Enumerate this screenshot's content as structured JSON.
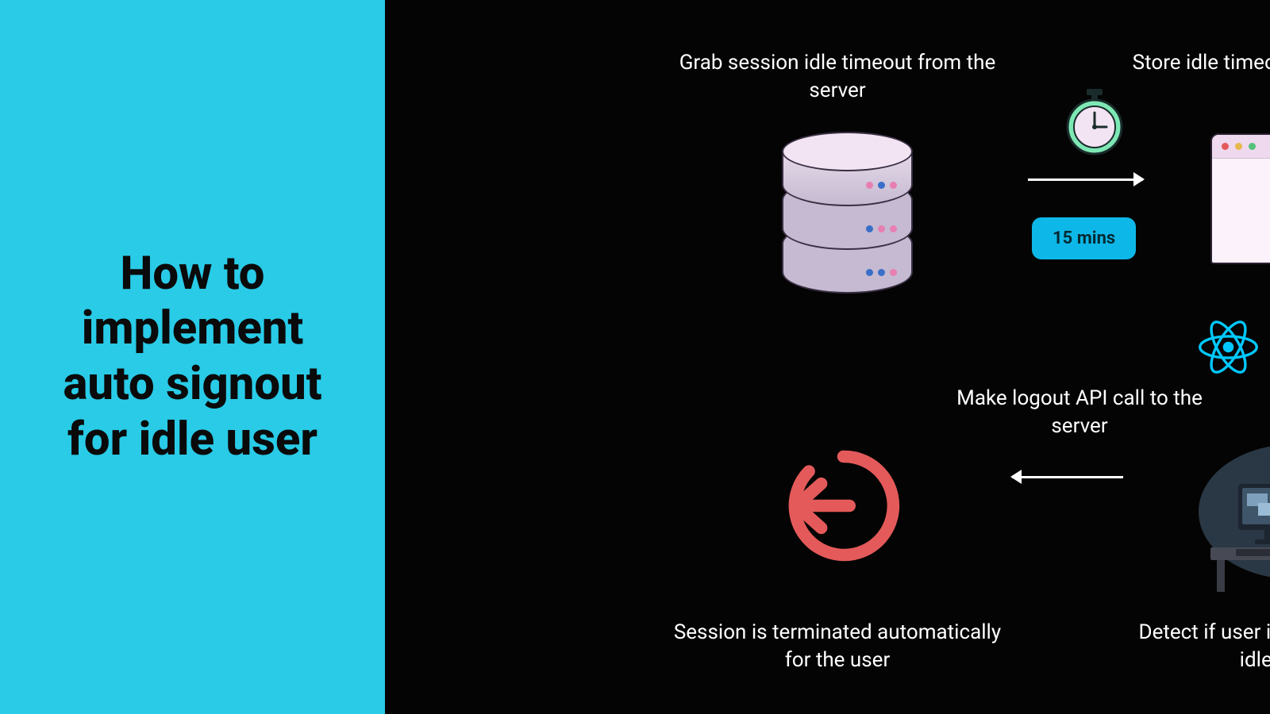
{
  "title": "How to implement auto signout for idle user",
  "steps": {
    "s1": "Grab session idle timeout from the server",
    "s2": "Store idle timeout on the client side",
    "s3": "Make logout API call to the server",
    "s4": "Session is terminated automatically for the user",
    "s5": "Detect if user is idle for more than idle timeout"
  },
  "timeout_badge": "15 mins",
  "colors": {
    "panel_left": "#29cbe7",
    "badge": "#0db8e8",
    "logout": "#e45a5a",
    "react": "#00c8ff"
  }
}
